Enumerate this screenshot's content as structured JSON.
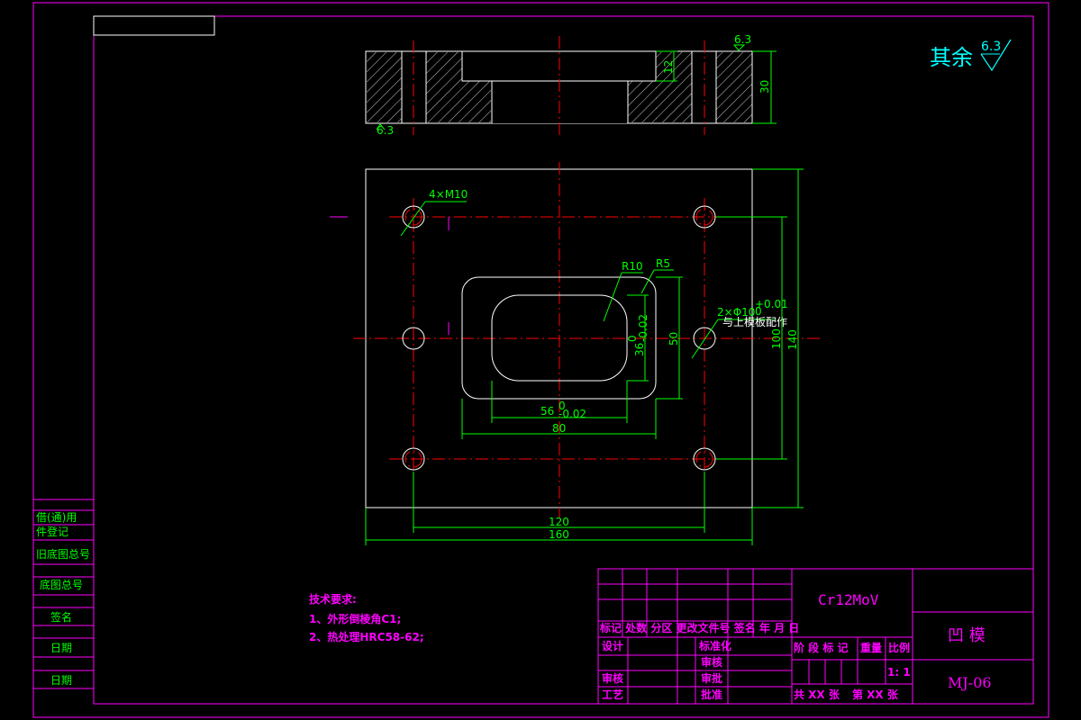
{
  "surface_finish": {
    "label": "其余",
    "value": "6.3"
  },
  "section_view": {
    "roughness_top": "6.3",
    "roughness_bottom": "6.3",
    "depth_dim": "12",
    "thickness_dim": "30"
  },
  "plan_view": {
    "hole_callout": "4×M10",
    "r10": "R10",
    "r5": "R5",
    "pin_callout": "2×Φ10",
    "pin_tol": "+0.01",
    "pin_tol_low": "0",
    "pin_note": "与上模板配作",
    "dim_36": "36",
    "dim_36_tol_up": "0",
    "dim_36_tol_low": "-0.02",
    "dim_50": "50",
    "dim_100": "100",
    "dim_140": "140",
    "dim_56": "56",
    "dim_56_tol_up": "0",
    "dim_56_tol_low": "-0.02",
    "dim_80": "80",
    "dim_120": "120",
    "dim_160": "160"
  },
  "tech_requirements": {
    "title": "技术要求:",
    "items": [
      "1、外形倒棱角C1;",
      "2、热处理HRC58-62;"
    ]
  },
  "left_strip": {
    "labels": [
      "借(通)用",
      "件登记",
      "旧底图总号",
      "底图总号",
      "签名",
      "日期",
      "日期"
    ]
  },
  "title_block": {
    "material": "Cr12MoV",
    "part_name": "凹  模",
    "drawing_no": "MJ-06",
    "revision_header": "标记 处数 分区 更改文件号 签名 年 月 日",
    "design": "设计",
    "standardize": "标准化",
    "check": "审核",
    "review": "审核",
    "process": "工艺",
    "approve": "批准",
    "approve2": "审批",
    "stage": "阶 段 标 记",
    "weight": "重量",
    "scale_label": "比例",
    "scale_value": "1: 1",
    "sheets": "共 XX 张",
    "sheet_no": "第 XX 张",
    "checked": "审核"
  },
  "colors": {
    "border": "#ff00ff",
    "dimension": "#00ff00",
    "center_line": "#ff0000",
    "outline": "#ffffff",
    "note": "#ff00ff",
    "finish": "#00ffff"
  }
}
